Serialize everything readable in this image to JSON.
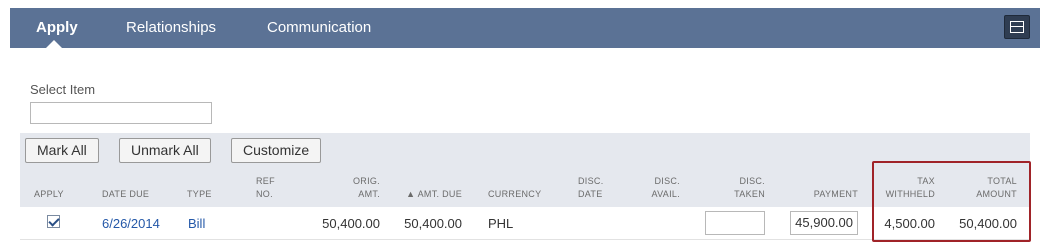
{
  "tabs": [
    {
      "label": "Apply",
      "active": true
    },
    {
      "label": "Relationships",
      "active": false
    },
    {
      "label": "Communication",
      "active": false
    }
  ],
  "layout_button": {
    "icon": "layout-toggle-icon"
  },
  "select_item": {
    "label": "Select Item",
    "value": ""
  },
  "toolbar": {
    "mark_all": "Mark All",
    "unmark_all": "Unmark All",
    "customize": "Customize"
  },
  "columns": {
    "apply": "APPLY",
    "date_due": "DATE DUE",
    "type": "TYPE",
    "ref_no_1": "REF",
    "ref_no_2": "NO.",
    "orig_amt_1": "ORIG.",
    "orig_amt_2": "AMT.",
    "amt_due": "▲ AMT. DUE",
    "currency": "CURRENCY",
    "disc_date_1": "DISC.",
    "disc_date_2": "DATE",
    "disc_avail_1": "DISC.",
    "disc_avail_2": "AVAIL.",
    "disc_taken_1": "DISC.",
    "disc_taken_2": "TAKEN",
    "payment": "PAYMENT",
    "tax_withheld_1": "TAX",
    "tax_withheld_2": "WITHHELD",
    "total_amount_1": "TOTAL",
    "total_amount_2": "AMOUNT"
  },
  "rows": [
    {
      "apply": true,
      "date_due": "6/26/2014",
      "type": "Bill",
      "ref_no": "",
      "orig_amt": "50,400.00",
      "amt_due": "50,400.00",
      "currency": "PHL",
      "disc_date": "",
      "disc_avail": "",
      "disc_taken": "",
      "payment": "45,900.00",
      "tax_withheld": "4,500.00",
      "total_amount": "50,400.00"
    }
  ],
  "colors": {
    "tabbar": "#5b7295",
    "highlight": "#a02328",
    "link": "#2458a8"
  }
}
